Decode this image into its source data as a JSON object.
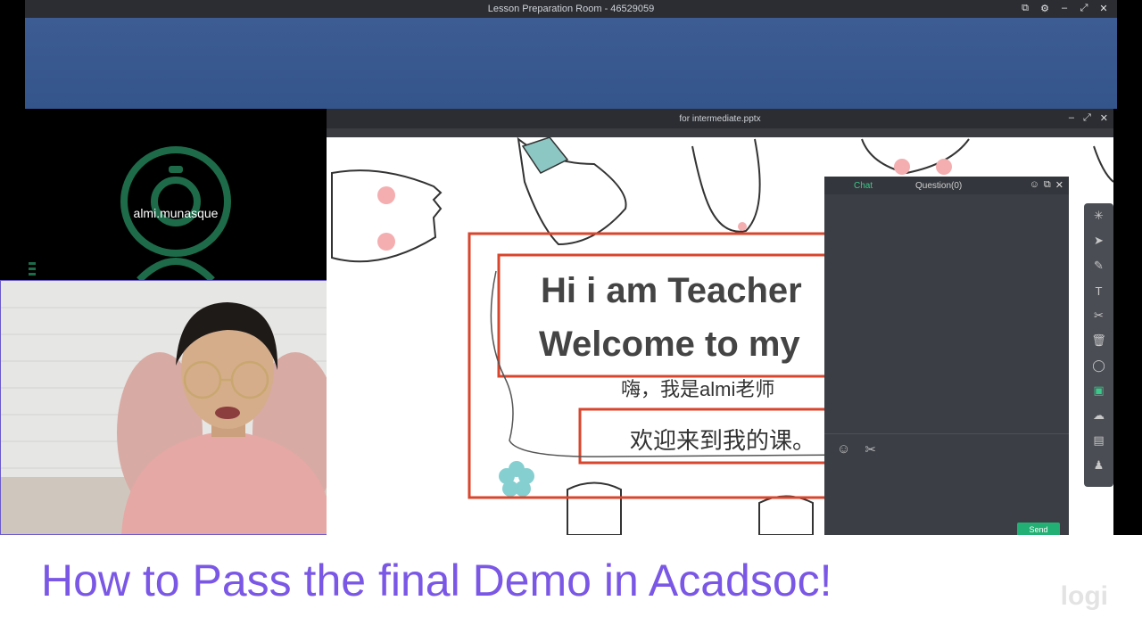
{
  "window": {
    "title": "Lesson Preparation Room - 46529059"
  },
  "camera1": {
    "name": "almi.munasque"
  },
  "presentation": {
    "title": "for intermediate.pptx"
  },
  "slide": {
    "line1": "Hi i am Teacher",
    "line2": "Welcome to my",
    "line3": "嗨，我是almi老师",
    "line4": "欢迎来到我的课。"
  },
  "chat": {
    "tab_chat": "Chat",
    "tab_question": "Question(0)",
    "send_label": "Send"
  },
  "caption": {
    "text": "How to Pass the final Demo in Acadsoc!",
    "watermark": "logi"
  },
  "colors": {
    "caption": "#7b57e6",
    "banner": "#3d5c94",
    "accent": "#23b074"
  }
}
